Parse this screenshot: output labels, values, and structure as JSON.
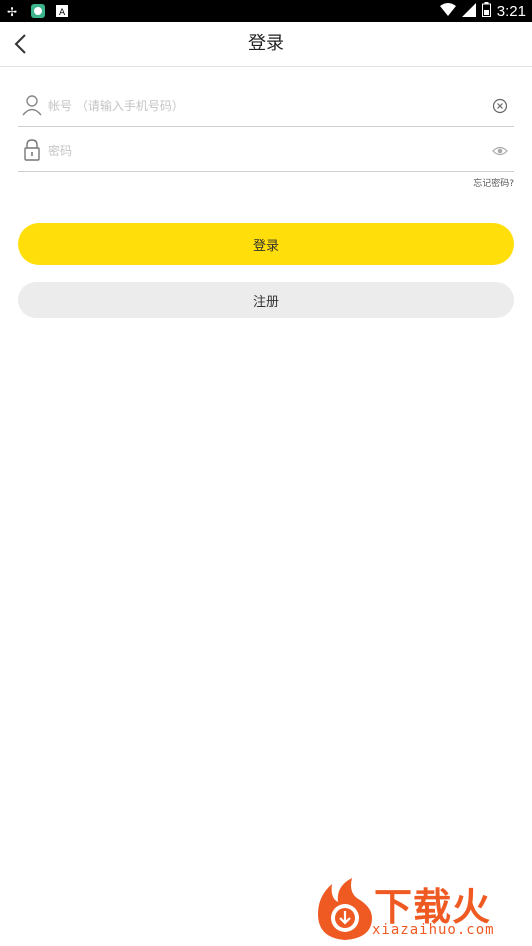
{
  "statusbar": {
    "time": "3:21",
    "left_icons": [
      "notification-app-icon",
      "notification-shield-icon",
      "notification-a-icon"
    ],
    "right_icons": [
      "wifi-icon",
      "signal-icon",
      "battery-icon"
    ]
  },
  "header": {
    "title": "登录",
    "back_icon": "chevron-left-icon"
  },
  "form": {
    "account": {
      "placeholder": "帐号 （请输入手机号码）",
      "value": "",
      "lead_icon": "user-icon",
      "trail_icon": "clear-icon"
    },
    "password": {
      "placeholder": "密码",
      "value": "",
      "lead_icon": "lock-icon",
      "trail_icon": "eye-icon"
    },
    "forgot_label": "忘记密码?",
    "login_label": "登录",
    "register_label": "注册"
  },
  "colors": {
    "primary": "#ffde0a",
    "secondary": "#ececec",
    "watermark": "#ef5a23"
  },
  "watermark": {
    "cn": "下载火",
    "en": "xiazaihuo.com"
  }
}
